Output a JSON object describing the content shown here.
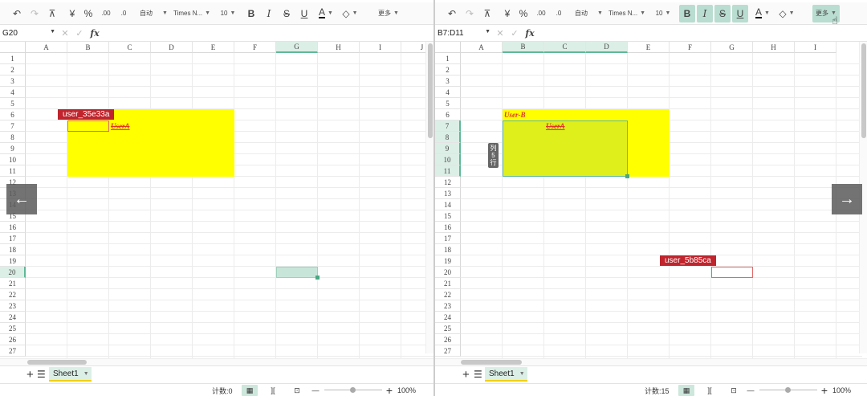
{
  "toolbar": {
    "undo": "↶",
    "redo": "↷",
    "format_painter": "⊼",
    "currency": "¥",
    "percent": "%",
    "decimal_increase": ".00",
    "decimal_decrease": ".0",
    "number_format": "自动",
    "font_name": "Times N...",
    "font_size": "10",
    "bold": "B",
    "italic": "I",
    "strikethrough": "S",
    "underline": "U",
    "font_color": "A",
    "fill_color": "◇",
    "more": "更多"
  },
  "left": {
    "name_box": "G20",
    "column_headers": [
      "A",
      "B",
      "C",
      "D",
      "E",
      "F",
      "G",
      "H",
      "I",
      "J"
    ],
    "highlight_column": "G",
    "highlight_row": "20",
    "rows": [
      "1",
      "2",
      "3",
      "4",
      "5",
      "6",
      "7",
      "8",
      "9",
      "10",
      "11",
      "12",
      "13",
      "14",
      "15",
      "16",
      "17",
      "18",
      "19",
      "20",
      "21",
      "22",
      "23",
      "24",
      "25",
      "26",
      "27"
    ],
    "collaborator_tag": "user_35e33a",
    "cell_text_c7": "UserA",
    "sheet_tab": "Sheet1",
    "status_count": "计数:0",
    "zoom": "100%"
  },
  "right": {
    "name_box": "B7:D11",
    "column_headers": [
      "A",
      "B",
      "C",
      "D",
      "E",
      "F",
      "G",
      "H",
      "I"
    ],
    "highlight_columns": [
      "B",
      "C",
      "D"
    ],
    "highlight_rows": [
      "7",
      "8",
      "9",
      "10",
      "11"
    ],
    "rows": [
      "1",
      "2",
      "3",
      "4",
      "5",
      "6",
      "7",
      "8",
      "9",
      "10",
      "11",
      "12",
      "13",
      "14",
      "15",
      "16",
      "17",
      "18",
      "19",
      "20",
      "21",
      "22",
      "23",
      "24",
      "25",
      "26",
      "27"
    ],
    "cell_text_b6": "User-B",
    "cell_text_c7": "UserA",
    "collaborator_tag": "user_5b85ca",
    "sheet_tab": "Sheet1",
    "status_count": "计数:15",
    "zoom": "100%",
    "side_tip": "列 5 行"
  },
  "nav": {
    "prev": "←",
    "next": "→"
  },
  "icons": {
    "add": "+",
    "menu": "☰",
    "zoom_out": "—",
    "zoom_in": "+",
    "fx": "fx",
    "cancel": "✕",
    "confirm": "✓",
    "normal_view": "▦",
    "page_break_view": "][",
    "page_layout_view": "⊡"
  },
  "colors": {
    "yellow_fill": "#ffff00",
    "selection_green": "#5fb898",
    "collab_red": "#c0242c",
    "cell_text_red": "#e0342c"
  }
}
